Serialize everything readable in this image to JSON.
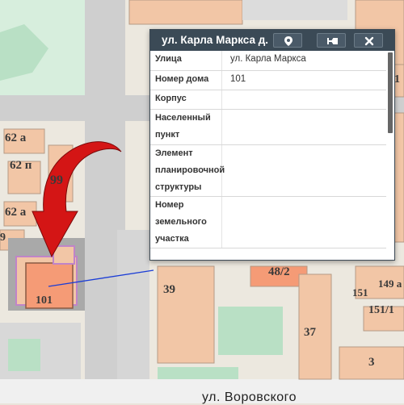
{
  "popup": {
    "title": "ул. Карла Маркса д.",
    "buttons": {
      "locate_icon": "map-pin",
      "pin_icon": "pushpin",
      "close_icon": "x"
    },
    "rows": [
      {
        "key": "Улица",
        "value": "ул. Карла Маркса"
      },
      {
        "key": "Номер дома",
        "value": "101"
      },
      {
        "key": "Корпус",
        "value": ""
      },
      {
        "key": "Населенный пункт",
        "value": ""
      },
      {
        "key": "Элемент планировочной структуры",
        "value": ""
      },
      {
        "key": "Номер земельного участка",
        "value": ""
      }
    ]
  },
  "map": {
    "house_labels": [
      "62 а",
      "62 п",
      "99",
      "62 а",
      "9",
      "101",
      "39",
      "48/2",
      "37",
      "3",
      "149 а",
      "151",
      "151/1",
      "1"
    ],
    "street": "ул. Воровского",
    "colors": {
      "building": "#f2c6a6",
      "highlight": "#f59b76",
      "parcel": "#c084c8",
      "road": "#cfcfcf",
      "green": "#b9e0c5"
    }
  }
}
